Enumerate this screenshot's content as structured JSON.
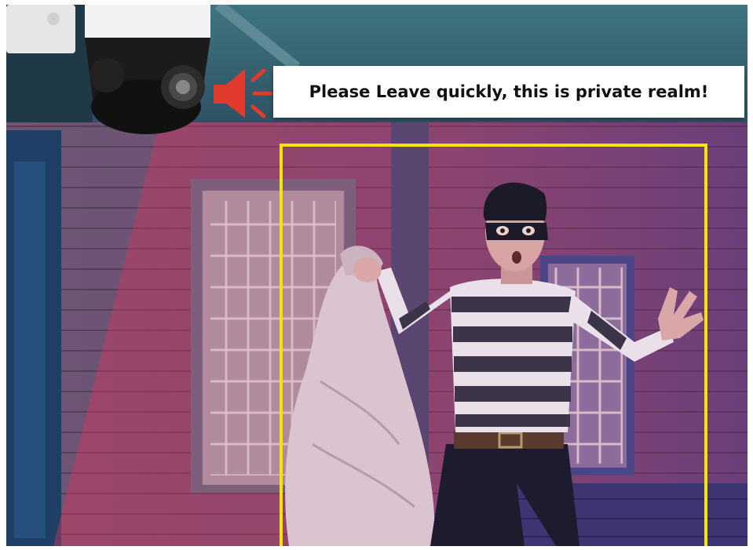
{
  "alert": {
    "message": "Please Leave quickly, this is private realm!"
  },
  "icons": {
    "speaker": "speaker-alarm-icon",
    "camera": "ptz-security-camera-icon"
  },
  "colors": {
    "detection_box": "#f5e400",
    "speaker_red": "#e23a2c",
    "light_beam": "#d23a5c"
  }
}
